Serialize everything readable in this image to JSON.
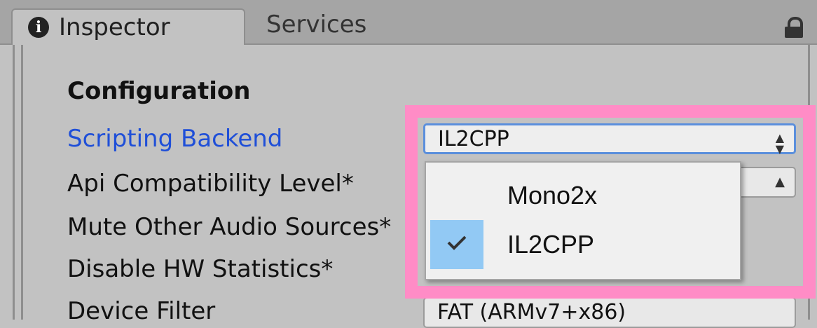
{
  "tabs": [
    {
      "label": "Inspector",
      "icon": "info-icon",
      "active": true
    },
    {
      "label": "Services",
      "active": false
    }
  ],
  "section": {
    "title": "Configuration"
  },
  "rows": [
    {
      "label": "Scripting Backend",
      "value": "IL2CPP"
    },
    {
      "label": "Api Compatibility Level*"
    },
    {
      "label": "Mute Other Audio Sources*"
    },
    {
      "label": "Disable HW Statistics*"
    },
    {
      "label": "Device Filter",
      "value": "FAT (ARMv7+x86)"
    }
  ],
  "dropdown_menu": {
    "options": [
      {
        "label": "Mono2x",
        "checked": false
      },
      {
        "label": "IL2CPP",
        "checked": true
      }
    ]
  },
  "colors": {
    "highlight": "#ff8cc6",
    "link_label": "#1f4fd8",
    "checked_bg": "#92c9f4"
  }
}
